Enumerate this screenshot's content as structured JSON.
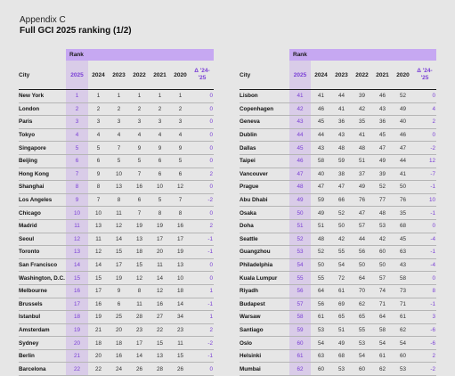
{
  "header": {
    "appendix": "Appendix C",
    "title": "Full GCI 2025 ranking (1/2)"
  },
  "table": {
    "rank_label": "Rank",
    "city_label": "City",
    "years": [
      "2025",
      "2024",
      "2023",
      "2022",
      "2021",
      "2020"
    ],
    "delta_label_1": "Δ '24-",
    "delta_label_2": "'25"
  },
  "left_rows": [
    [
      "New York",
      "1",
      "1",
      "1",
      "1",
      "1",
      "1",
      "0"
    ],
    [
      "London",
      "2",
      "2",
      "2",
      "2",
      "2",
      "2",
      "0"
    ],
    [
      "Paris",
      "3",
      "3",
      "3",
      "3",
      "3",
      "3",
      "0"
    ],
    [
      "Tokyo",
      "4",
      "4",
      "4",
      "4",
      "4",
      "4",
      "0"
    ],
    [
      "Singapore",
      "5",
      "5",
      "7",
      "9",
      "9",
      "9",
      "0"
    ],
    [
      "Beijing",
      "6",
      "6",
      "5",
      "5",
      "6",
      "5",
      "0"
    ],
    [
      "Hong Kong",
      "7",
      "9",
      "10",
      "7",
      "6",
      "6",
      "2"
    ],
    [
      "Shanghai",
      "8",
      "8",
      "13",
      "16",
      "10",
      "12",
      "0"
    ],
    [
      "Los Angeles",
      "9",
      "7",
      "8",
      "6",
      "5",
      "7",
      "-2"
    ],
    [
      "Chicago",
      "10",
      "10",
      "11",
      "7",
      "8",
      "8",
      "0"
    ],
    [
      "Madrid",
      "11",
      "13",
      "12",
      "19",
      "19",
      "16",
      "2"
    ],
    [
      "Seoul",
      "12",
      "11",
      "14",
      "13",
      "17",
      "17",
      "-1"
    ],
    [
      "Toronto",
      "13",
      "12",
      "15",
      "18",
      "20",
      "19",
      "-1"
    ],
    [
      "San Francisco",
      "14",
      "14",
      "17",
      "15",
      "11",
      "13",
      "0"
    ],
    [
      "Washington, D.C.",
      "15",
      "15",
      "19",
      "12",
      "14",
      "10",
      "0"
    ],
    [
      "Melbourne",
      "16",
      "17",
      "9",
      "8",
      "12",
      "18",
      "1"
    ],
    [
      "Brussels",
      "17",
      "16",
      "6",
      "11",
      "16",
      "14",
      "-1"
    ],
    [
      "Istanbul",
      "18",
      "19",
      "25",
      "28",
      "27",
      "34",
      "1"
    ],
    [
      "Amsterdam",
      "19",
      "21",
      "20",
      "23",
      "22",
      "23",
      "2"
    ],
    [
      "Sydney",
      "20",
      "18",
      "18",
      "17",
      "15",
      "11",
      "-2"
    ],
    [
      "Berlin",
      "21",
      "20",
      "16",
      "14",
      "13",
      "15",
      "-1"
    ],
    [
      "Barcelona",
      "22",
      "22",
      "24",
      "26",
      "28",
      "26",
      "0"
    ]
  ],
  "right_rows": [
    [
      "Lisbon",
      "41",
      "41",
      "44",
      "39",
      "46",
      "52",
      "0"
    ],
    [
      "Copenhagen",
      "42",
      "46",
      "41",
      "42",
      "43",
      "49",
      "4"
    ],
    [
      "Geneva",
      "43",
      "45",
      "36",
      "35",
      "36",
      "40",
      "2"
    ],
    [
      "Dublin",
      "44",
      "44",
      "43",
      "41",
      "45",
      "46",
      "0"
    ],
    [
      "Dallas",
      "45",
      "43",
      "48",
      "48",
      "47",
      "47",
      "-2"
    ],
    [
      "Taipei",
      "46",
      "58",
      "59",
      "51",
      "49",
      "44",
      "12"
    ],
    [
      "Vancouver",
      "47",
      "40",
      "38",
      "37",
      "39",
      "41",
      "-7"
    ],
    [
      "Prague",
      "48",
      "47",
      "47",
      "49",
      "52",
      "50",
      "-1"
    ],
    [
      "Abu Dhabi",
      "49",
      "59",
      "66",
      "76",
      "77",
      "76",
      "10"
    ],
    [
      "Osaka",
      "50",
      "49",
      "52",
      "47",
      "48",
      "35",
      "-1"
    ],
    [
      "Doha",
      "51",
      "51",
      "50",
      "57",
      "53",
      "68",
      "0"
    ],
    [
      "Seattle",
      "52",
      "48",
      "42",
      "44",
      "42",
      "45",
      "-4"
    ],
    [
      "Guangzhou",
      "53",
      "52",
      "55",
      "56",
      "60",
      "63",
      "-1"
    ],
    [
      "Philadelphia",
      "54",
      "50",
      "54",
      "50",
      "50",
      "43",
      "-4"
    ],
    [
      "Kuala Lumpur",
      "55",
      "55",
      "72",
      "64",
      "57",
      "58",
      "0"
    ],
    [
      "Riyadh",
      "56",
      "64",
      "61",
      "70",
      "74",
      "73",
      "8"
    ],
    [
      "Budapest",
      "57",
      "56",
      "69",
      "62",
      "71",
      "71",
      "-1"
    ],
    [
      "Warsaw",
      "58",
      "61",
      "65",
      "65",
      "64",
      "61",
      "3"
    ],
    [
      "Santiago",
      "59",
      "53",
      "51",
      "55",
      "58",
      "62",
      "-6"
    ],
    [
      "Oslo",
      "60",
      "54",
      "49",
      "53",
      "54",
      "54",
      "-6"
    ],
    [
      "Helsinki",
      "61",
      "63",
      "68",
      "54",
      "61",
      "60",
      "2"
    ],
    [
      "Mumbai",
      "62",
      "60",
      "53",
      "60",
      "62",
      "53",
      "-2"
    ]
  ]
}
